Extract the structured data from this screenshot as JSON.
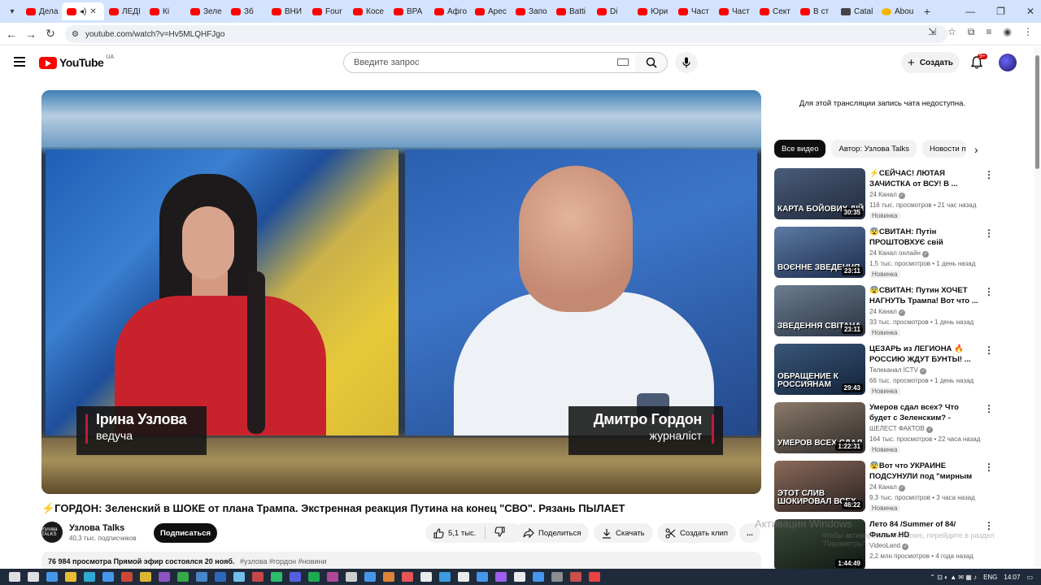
{
  "browser": {
    "tabs": [
      {
        "label": "Дела",
        "icon": "youtube-icon"
      },
      {
        "label": "",
        "icon": "youtube-icon",
        "active": true
      },
      {
        "label": "ЛЕДІ",
        "icon": "youtube-icon"
      },
      {
        "label": "Кі",
        "icon": "youtube-icon"
      },
      {
        "label": "Зеле",
        "icon": "youtube-icon"
      },
      {
        "label": "Зб",
        "icon": "youtube-icon"
      },
      {
        "label": "ВНИ",
        "icon": "youtube-icon"
      },
      {
        "label": "Four",
        "icon": "youtube-icon"
      },
      {
        "label": "Косе",
        "icon": "youtube-icon"
      },
      {
        "label": "ВРА",
        "icon": "youtube-icon"
      },
      {
        "label": "Афго",
        "icon": "youtube-icon"
      },
      {
        "label": "Арес",
        "icon": "youtube-icon"
      },
      {
        "label": "Запо",
        "icon": "youtube-icon"
      },
      {
        "label": "Batti",
        "icon": "youtube-icon"
      },
      {
        "label": "Di",
        "icon": "youtube-icon"
      },
      {
        "label": "Юри",
        "icon": "youtube-icon"
      },
      {
        "label": "Част",
        "icon": "youtube-icon"
      },
      {
        "label": "Част",
        "icon": "youtube-icon"
      },
      {
        "label": "Сект",
        "icon": "youtube-icon"
      },
      {
        "label": "В ст",
        "icon": "youtube-icon"
      },
      {
        "label": "Catal",
        "icon": "other-icon"
      },
      {
        "label": "Abou",
        "icon": "yellow-icon"
      }
    ],
    "url": "youtube.com/watch?v=Hv5MLQHFJgo"
  },
  "header": {
    "logo_text": "YouTube",
    "country": "UA",
    "search_placeholder": "Введите запрос",
    "create_label": "Создать",
    "notif_badge": "9+"
  },
  "video": {
    "host_name": "Ірина Узлова",
    "host_role": "ведуча",
    "guest_name": "Дмитро Гордон",
    "guest_role": "журналіст",
    "title": "⚡ГОРДОН: Зеленский в ШОКЕ от плана Трампа. Экстренная реакция Путина на конец \"СВО\". Рязань ПЫЛАЕТ"
  },
  "channel": {
    "name": "Узлова Talks",
    "avatar_text": "Узлова TALKS",
    "subs": "40,3 тыс. подписчиков",
    "subscribe_label": "Подписаться"
  },
  "actions": {
    "likes": "5,1 тыс.",
    "share": "Поделиться",
    "download": "Скачать",
    "clip": "Создать клип",
    "more": "..."
  },
  "description": {
    "meta": "76 984 просмотра  Прямой эфир состоялся 20 нояб.",
    "tags": "#узлова #гордон #новини"
  },
  "sidebar": {
    "chat_note": "Для этой трансляции запись чата недоступна.",
    "chips": [
      "Все видео",
      "Автор: Узлова Talks",
      "Новости по"
    ],
    "recs": [
      {
        "title": "⚡СЕЙЧАС! ЛЮТАЯ ЗАЧИСТКА от ВСУ! В ...",
        "channel": "24 Канал",
        "meta": "116 тыс. просмотров • 21 час назад",
        "new": "Новинка",
        "duration": "30:35",
        "caption": "КАРТА БОЙОВИХ ДІЙ",
        "colors": [
          "#4a5d7a",
          "#20293a"
        ]
      },
      {
        "title": "😨СВИТАН: Путін ПРОШТОВХУЄ свій сценарій!...",
        "channel": "24 Канал онлайн",
        "meta": "1,5 тыс. просмотров • 1 день назад",
        "new": "Новинка",
        "duration": "23:11",
        "caption": "ВОЄННЕ ЗВЕДЕННЯ",
        "colors": [
          "#5c7aa3",
          "#1b2b4a"
        ]
      },
      {
        "title": "😨СВИТАН: Путин ХОЧЕТ НАГНУТЬ Трампа! Вот что ...",
        "channel": "24 Канал",
        "meta": "33 тыс. просмотров • 1 день назад",
        "new": "Новинка",
        "duration": "23:11",
        "caption": "ЗВЕДЕННЯ СВІТАНА",
        "colors": [
          "#6a7d8f",
          "#2a3342"
        ]
      },
      {
        "title": "ЦЕЗАРЬ из ЛЕГИОНА 🔥 РОССИЮ ЖДУТ БУНТЫ! ...",
        "channel": "Телеканал ICTV",
        "meta": "66 тыс. просмотров • 1 день назад",
        "new": "Новинка",
        "duration": "29:43",
        "caption": "ОБРАЩЕНИЕ К РОССИЯНАМ",
        "colors": [
          "#3a5778",
          "#13233a"
        ]
      },
      {
        "title": "Умеров сдал всех? Что будет с Зеленским? - Мосийчук",
        "channel": "ШЕЛЕСТ ФАКТОВ",
        "meta": "164 тыс. просмотров • 22 часа назад",
        "new": "Новинка",
        "duration": "1:22:31",
        "caption": "УМЕРОВ ВСЕХ СДАЛ",
        "colors": [
          "#8a7a6a",
          "#2e2a28"
        ]
      },
      {
        "title": "😨Вот что УКРАИНЕ ПОДСУНУЛИ под \"мирным ...",
        "channel": "24 Канал",
        "meta": "9,3 тыс. просмотров • 3 часа назад",
        "new": "Новинка",
        "duration": "46:22",
        "caption": "ЭТОТ СЛИВ ШОКИРОВАЛ ВСЕХ",
        "colors": [
          "#8a6a5a",
          "#2a2020"
        ]
      },
      {
        "title": "Лето 84 /Summer of 84/ Фильм HD",
        "channel": "VideoLand",
        "meta": "2,2 млн просмотров • 4 года назад",
        "new": "",
        "duration": "1:44:49",
        "caption": "",
        "colors": [
          "#3c4a3a",
          "#101812"
        ]
      }
    ]
  },
  "windows_watermark": {
    "line1": "Активация Windows",
    "line2": "Чтобы активировать Windows, перейдите в раздел \"Параметры\"."
  },
  "taskbar": {
    "lang": "ENG",
    "time": "14:07"
  }
}
